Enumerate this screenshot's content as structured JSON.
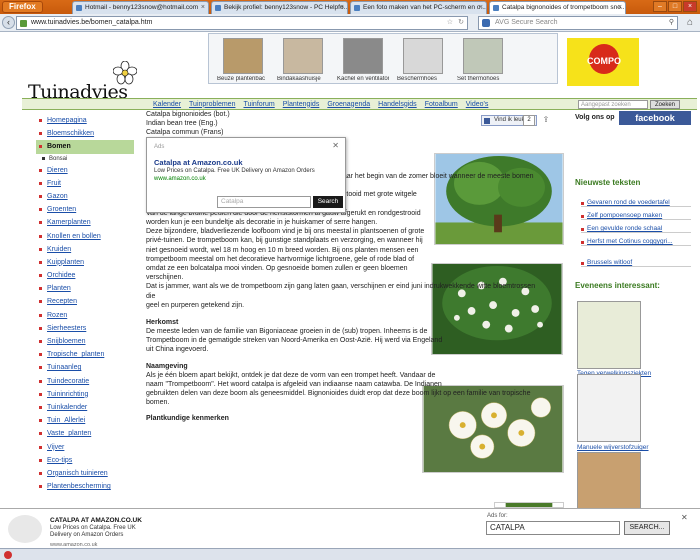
{
  "browser": {
    "menu_button": "Firefox",
    "tabs": [
      {
        "label": "Hotmail - benny123snow@hotmail.com",
        "active": false
      },
      {
        "label": "Bekijk profiel: benny123snow - PC Helpfo...",
        "active": false
      },
      {
        "label": "Een foto maken van het PC-scherm en o...",
        "active": false
      },
      {
        "label": "Catalpa bignonoides of trompetboom sno...",
        "active": true
      }
    ],
    "url": "www.tuinadvies.be/bomen_catalpa.htm",
    "search_placeholder": "AVG Secure Search"
  },
  "header": {
    "logo_text": "Tuinadvies",
    "promo": [
      {
        "label": "Beuze plantenbac"
      },
      {
        "label": "Bindakaashuisje"
      },
      {
        "label": "Kachel en ventilator"
      },
      {
        "label": "Beschermhoes"
      },
      {
        "label": "Set thermohoes"
      }
    ],
    "compo_logo": "COMPO"
  },
  "mainnav": {
    "items": [
      "Kalender",
      "Tuinproblemen",
      "Tuinforum",
      "Plantengids",
      "Groenagenda",
      "Handelsgids",
      "Fotoalbum",
      "Video's"
    ],
    "search_placeholder": "Aangepast zoeken",
    "search_button": "Zoeken"
  },
  "sidebar": {
    "items": [
      {
        "label": "Homepagina",
        "type": "item"
      },
      {
        "label": "Bloemschikken",
        "type": "item"
      },
      {
        "label": "Bomen",
        "type": "active"
      },
      {
        "label": "Bonsai",
        "type": "sub"
      },
      {
        "label": "Dieren",
        "type": "item"
      },
      {
        "label": "Fruit",
        "type": "item"
      },
      {
        "label": "Gazon",
        "type": "item"
      },
      {
        "label": "Groenten",
        "type": "item"
      },
      {
        "label": "Kamerplanten",
        "type": "item"
      },
      {
        "label": "Knollen en bollen",
        "type": "item"
      },
      {
        "label": "Kruiden",
        "type": "item"
      },
      {
        "label": "Kuipplanten",
        "type": "item"
      },
      {
        "label": "Orchidee",
        "type": "item"
      },
      {
        "label": "Planten",
        "type": "item"
      },
      {
        "label": "Recepten",
        "type": "item"
      },
      {
        "label": "Rozen",
        "type": "item"
      },
      {
        "label": "Sierheesters",
        "type": "item"
      },
      {
        "label": "Snijbloemen",
        "type": "item"
      },
      {
        "label": "Tropische_planten",
        "type": "item"
      },
      {
        "label": "Tuinaanleg",
        "type": "item"
      },
      {
        "label": "Tuindecoratie",
        "type": "item"
      },
      {
        "label": "Tuininrichting",
        "type": "item"
      },
      {
        "label": "Tuinkalender",
        "type": "item"
      },
      {
        "label": "Tuin_Allerlei",
        "type": "item"
      },
      {
        "label": "Vaste_planten",
        "type": "item"
      },
      {
        "label": "Vijver",
        "type": "item"
      },
      {
        "label": "Eco-tips",
        "type": "item"
      },
      {
        "label": "Organisch tuinieren",
        "type": "item"
      },
      {
        "label": "Plantenbescherming",
        "type": "item"
      }
    ]
  },
  "social": {
    "like_label": "Vind ik leuk",
    "like_count": "2",
    "follow_label": "Volg ons op",
    "facebook": "facebook"
  },
  "content": {
    "names": [
      "Catalpa bignonioides (bot.)",
      "Indian bean tree (Eng.)",
      "Catalpa commun (Frans)",
      "Trompetenbaum, Zigarrenbaum (Duits)"
    ],
    "family": "Bignoniaceae – trompetboomfamilie",
    "intro": [
      "Ik kijk ieder jaar weer vol verbazing naar de Trompetboom die naar het begin van de zomer bloeit wanneer de meeste bomen en",
      "struiken eromheen al lang uitgebloeid zijn. Hij is dan feestelijk getooid met grote witgele",
      "bloemen.",
      "Van de lange bruine peulen die door de herfststormen al gauw afgerukt en rondgestrooid",
      "worden kun je een bundeltje als decoratie in je huiskamer of serre hangen.",
      "Deze bijzondere, bladverliezende loofboom vind je bij ons meestal in plantsoenen of grote",
      "privé-tuinen. De trompetboom kan, bij gunstige standplaats en verzorging, en wanneer hij",
      "niet gesnoeid wordt, wel 18 m hoog en 10 m breed worden. Bij ons planten mensen een",
      "trompetboom meestal om het decoratieve hartvormige lichtgroene, gele of rode blad of",
      "omdat ze een bolcatalpa mooi vinden. Op gesnoeide bomen zullen er geen bloemen",
      "verschijnen.",
      "Dat is jammer, want als we de trompetboom zijn gang laten gaan, verschijnen er eind juni indrukwekkende witte bloemtrossen die",
      "geel en purperen getekend zijn."
    ],
    "herkomst_title": "Herkomst",
    "herkomst": [
      "De meeste leden van de familie van Bigoniaceae groeien in de (sub) tropen. Inheems is de",
      "Trompetboom in de gematigde streken van Noord-Amerika en Oost-Azië. Hij werd via Engeland",
      "uit China ingevoerd."
    ],
    "naamgeving_title": "Naamgeving",
    "naamgeving": [
      "Als je één bloem apart bekijkt, ontdek je dat deze de vorm van een trompet heeft. Vandaar de",
      "naam \"Trompetboom\". Het woord catalpa is afgeleid van indiaanse naam catawba. De Indianen",
      "gebruikten delen van deze boom als geneesmiddel. Bignonioides duidt erop dat deze boom lijkt op een familie van tropische bomen."
    ],
    "kenmerken_title": "Plantkundige kenmerken"
  },
  "rightcol": {
    "nieuwste_title": "Nieuwste teksten",
    "nieuwste": [
      "Gevaren rond de voedertafel",
      "Zelf pompoensoep maken",
      "Een gevulde ronde schaal",
      "Herfst met Cotinus coggygri...",
      "Brussels witloof"
    ],
    "eveneens_title": "Eveneens interessant:",
    "products": [
      "Tegen verwelkingsziekten",
      "Manuele wijverstofzuiger",
      "Dakgoottreiniger"
    ]
  },
  "popup": {
    "ads_label": "Ads",
    "title": "Catalpa at Amazon.co.uk",
    "desc": "Low Prices on Catalpa. Free UK Delivery on Amazon Orders",
    "url": "www.amazon.co.uk",
    "input_value": "Catalpa",
    "button": "Search"
  },
  "bottomad": {
    "title": "CATALPA AT AMAZON.CO.UK",
    "desc": "Low Prices on Catalpa. Free UK Delivery on Amazon Orders",
    "url": "www.amazon.co.uk",
    "ads_label": "Ads for:",
    "input_value": "CATALPA",
    "button": "SEARCH..."
  }
}
